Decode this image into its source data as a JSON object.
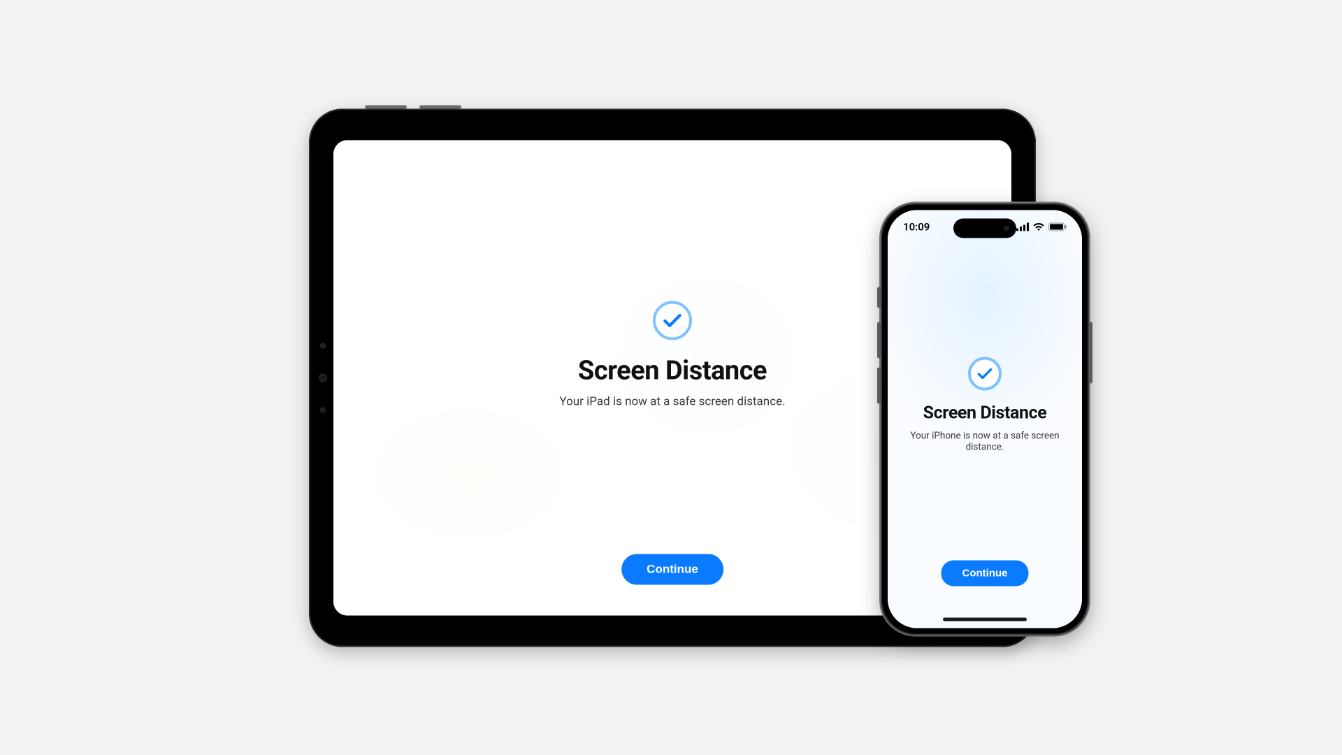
{
  "colors": {
    "accent": "#0a7bff",
    "check_ring": "#7ec2ff"
  },
  "ipad": {
    "title": "Screen Distance",
    "subtitle": "Your iPad is now at a safe screen distance.",
    "continue_label": "Continue"
  },
  "iphone": {
    "status_time": "10:09",
    "title": "Screen Distance",
    "subtitle": "Your iPhone is now at a safe screen distance.",
    "continue_label": "Continue"
  }
}
